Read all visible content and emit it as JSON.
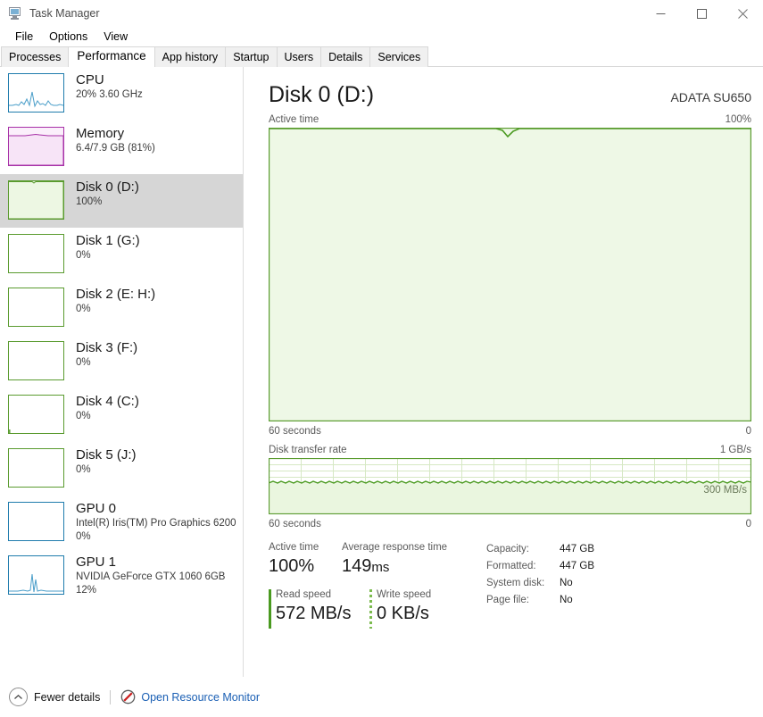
{
  "window": {
    "title": "Task Manager",
    "icon": "task-manager-icon",
    "minimize": "–",
    "maximize": "□",
    "close": "✕"
  },
  "menubar": {
    "items": [
      "File",
      "Options",
      "View"
    ]
  },
  "tabs": [
    {
      "label": "Processes",
      "active": false
    },
    {
      "label": "Performance",
      "active": true
    },
    {
      "label": "App history",
      "active": false
    },
    {
      "label": "Startup",
      "active": false
    },
    {
      "label": "Users",
      "active": false
    },
    {
      "label": "Details",
      "active": false
    },
    {
      "label": "Services",
      "active": false
    }
  ],
  "sidebar": {
    "items": [
      {
        "name": "CPU",
        "sub": "20%  3.60 GHz",
        "sub2": "",
        "kind": "cpu",
        "selected": false
      },
      {
        "name": "Memory",
        "sub": "6.4/7.9 GB (81%)",
        "sub2": "",
        "kind": "memory",
        "selected": false
      },
      {
        "name": "Disk 0 (D:)",
        "sub": "100%",
        "sub2": "",
        "kind": "disk-active",
        "selected": true
      },
      {
        "name": "Disk 1 (G:)",
        "sub": "0%",
        "sub2": "",
        "kind": "disk",
        "selected": false
      },
      {
        "name": "Disk 2 (E: H:)",
        "sub": "0%",
        "sub2": "",
        "kind": "disk",
        "selected": false
      },
      {
        "name": "Disk 3 (F:)",
        "sub": "0%",
        "sub2": "",
        "kind": "disk",
        "selected": false
      },
      {
        "name": "Disk 4 (C:)",
        "sub": "0%",
        "sub2": "",
        "kind": "disk",
        "selected": false
      },
      {
        "name": "Disk 5 (J:)",
        "sub": "0%",
        "sub2": "",
        "kind": "disk",
        "selected": false
      },
      {
        "name": "GPU 0",
        "sub": "Intel(R) Iris(TM) Pro Graphics 6200",
        "sub2": "0%",
        "kind": "gpu0",
        "selected": false
      },
      {
        "name": "GPU 1",
        "sub": "NVIDIA GeForce GTX 1060 6GB",
        "sub2": "12%",
        "kind": "gpu1",
        "selected": false
      }
    ]
  },
  "footer": {
    "fewer_details": "Fewer details",
    "resource_monitor": "Open Resource Monitor",
    "chevron_icon": "chevron-up-icon",
    "resmon_icon": "resource-monitor-icon"
  },
  "detail": {
    "title": "Disk 0 (D:)",
    "model": "ADATA SU650",
    "active_graph": {
      "label": "Active time",
      "max_label": "100%",
      "x_left": "60 seconds",
      "x_right": "0"
    },
    "transfer_graph": {
      "label": "Disk transfer rate",
      "max_label": "1 GB/s",
      "inline_label": "300 MB/s",
      "x_left": "60 seconds",
      "x_right": "0"
    },
    "stats": {
      "active_time_label": "Active time",
      "active_time_value": "100%",
      "avg_response_label": "Average response time",
      "avg_response_value": "149",
      "avg_response_unit": "ms",
      "read_speed_label": "Read speed",
      "read_speed_value": "572 MB/s",
      "write_speed_label": "Write speed",
      "write_speed_value": "0 KB/s"
    },
    "info": [
      {
        "label": "Capacity:",
        "value": "447 GB"
      },
      {
        "label": "Formatted:",
        "value": "447 GB"
      },
      {
        "label": "System disk:",
        "value": "No"
      },
      {
        "label": "Page file:",
        "value": "No"
      }
    ]
  },
  "chart_data": [
    {
      "type": "area",
      "title": "Active time",
      "ylabel": "Active time",
      "xlabel": "60 seconds",
      "ylim": [
        0,
        100
      ],
      "yunit": "%",
      "xlim_seconds": 60,
      "grid": true,
      "line_color": "#4a9a20",
      "fill_color": "#eef8e6",
      "values_percent": [
        100,
        100,
        100,
        100,
        100,
        100,
        100,
        100,
        100,
        100,
        100,
        100,
        100,
        100,
        100,
        100,
        100,
        100,
        100,
        100,
        100,
        100,
        100,
        100,
        100,
        100,
        100,
        100,
        100,
        100,
        100,
        100,
        100,
        100,
        100,
        100,
        100,
        100,
        100,
        100,
        100,
        100,
        100,
        100,
        100,
        100,
        97,
        94,
        97,
        100,
        100,
        100,
        100,
        100,
        100,
        100,
        100,
        100,
        100,
        100
      ]
    },
    {
      "type": "area",
      "title": "Disk transfer rate",
      "ylabel": "Disk transfer rate",
      "xlabel": "60 seconds",
      "ylim": [
        0,
        1024
      ],
      "yunit": "MB/s",
      "ymax_label": "1 GB/s",
      "annotation": "300 MB/s",
      "grid": true,
      "line_color": "#4a9a20",
      "fill_color": "#eef8e6",
      "values_mbps": [
        575,
        560,
        580,
        558,
        578,
        556,
        582,
        560,
        576,
        558,
        580,
        556,
        578,
        562,
        580,
        556,
        575,
        560,
        582,
        558,
        576,
        560,
        578,
        556,
        580,
        562,
        575,
        558,
        582,
        556,
        578,
        560,
        576,
        558,
        580,
        556,
        578,
        562,
        580,
        558,
        575,
        560,
        582,
        556,
        578,
        560,
        576,
        558,
        580,
        562,
        578,
        556,
        582,
        560,
        575,
        558,
        580,
        556,
        578,
        572
      ]
    }
  ]
}
